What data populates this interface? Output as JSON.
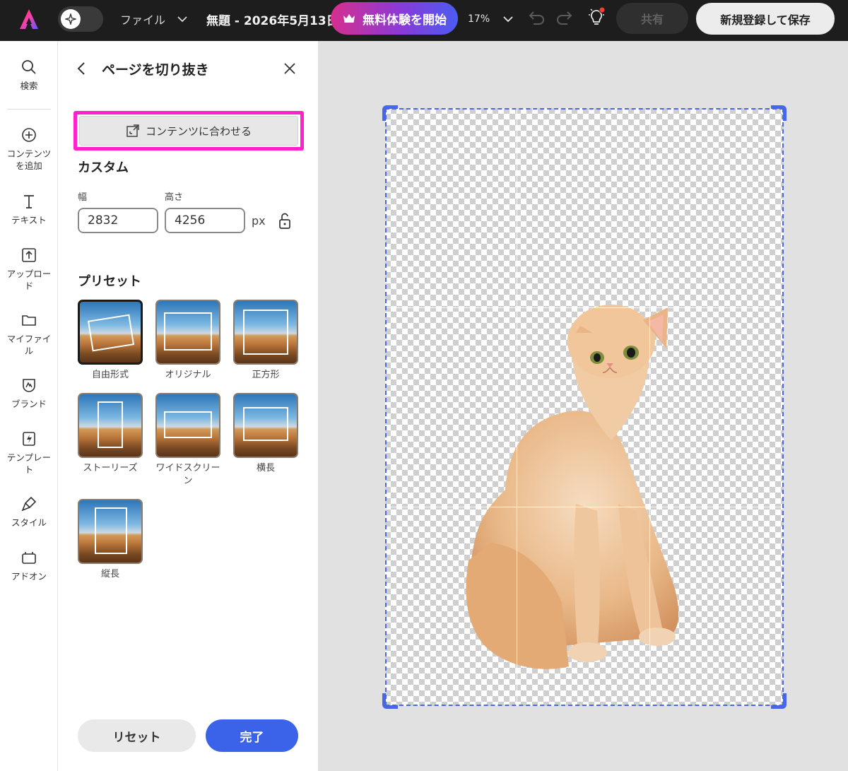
{
  "topbar": {
    "file_menu_label": "ファイル",
    "document_title": "無題 - 2026年5月13日",
    "trial_label": "無料体験を開始",
    "zoom_level": "17%",
    "share_label": "共有",
    "signup_save_label": "新規登録して保存"
  },
  "rail": {
    "items": [
      {
        "label": "検索",
        "icon": "search-icon"
      },
      {
        "label": "コンテンツを追加",
        "icon": "add-content-icon"
      },
      {
        "label": "テキスト",
        "icon": "text-icon"
      },
      {
        "label": "アップロード",
        "icon": "upload-icon"
      },
      {
        "label": "マイファイル",
        "icon": "folder-icon"
      },
      {
        "label": "ブランド",
        "icon": "brand-icon"
      },
      {
        "label": "テンプレート",
        "icon": "template-icon"
      },
      {
        "label": "スタイル",
        "icon": "style-icon"
      },
      {
        "label": "アドオン",
        "icon": "addon-icon"
      }
    ]
  },
  "panel": {
    "title": "ページを切り抜き",
    "fit_content_label": "コンテンツに合わせる",
    "custom_heading": "カスタム",
    "width_label": "幅",
    "width_value": "2832",
    "height_label": "高さ",
    "height_value": "4256",
    "unit": "px",
    "preset_heading": "プリセット",
    "presets": [
      {
        "label": "自由形式",
        "selected": true
      },
      {
        "label": "オリジナル",
        "selected": false
      },
      {
        "label": "正方形",
        "selected": false
      },
      {
        "label": "ストーリーズ",
        "selected": false
      },
      {
        "label": "ワイドスクリーン",
        "selected": false
      },
      {
        "label": "横長",
        "selected": false
      },
      {
        "label": "縦長",
        "selected": false
      }
    ],
    "reset_label": "リセット",
    "done_label": "完了"
  },
  "colors": {
    "accent": "#3b63e9",
    "highlight": "#ff22cc",
    "crop_border": "#4866e8"
  }
}
